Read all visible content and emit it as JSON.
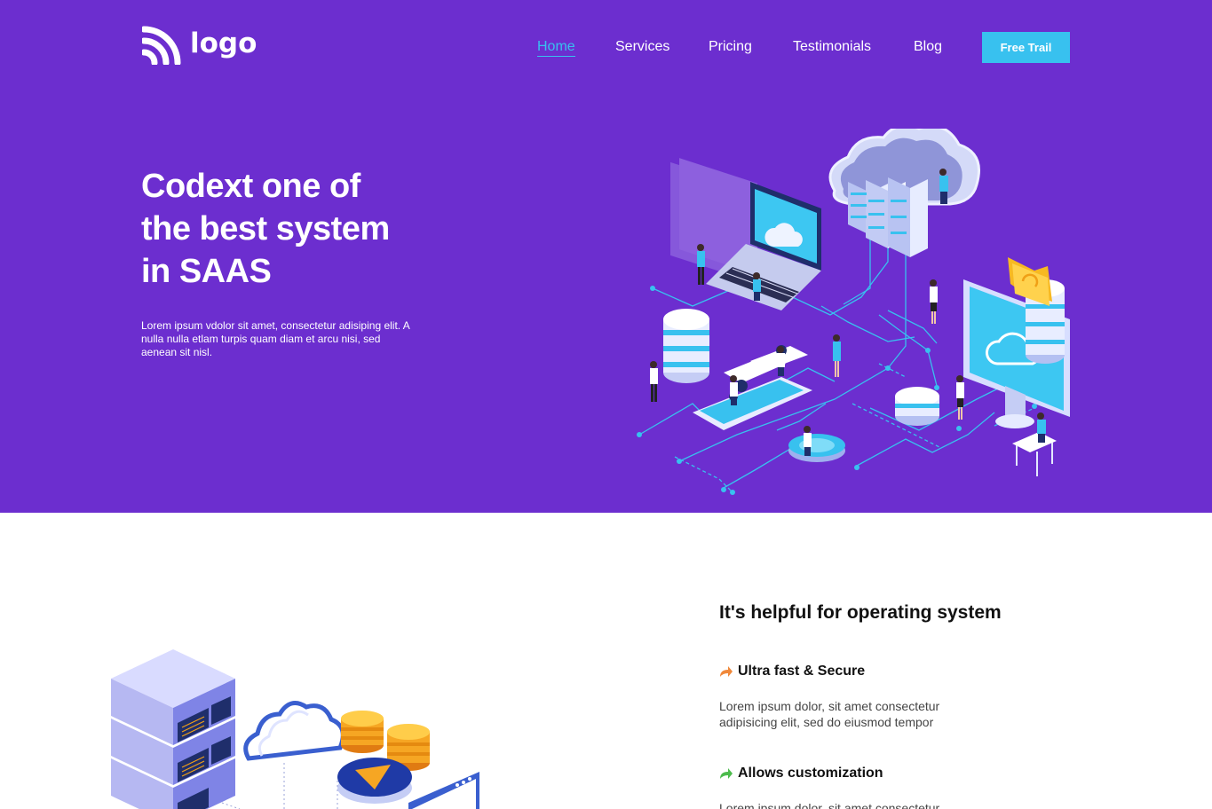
{
  "brand": {
    "name": "logo",
    "icon": "wifi-signal-icon"
  },
  "nav": {
    "items": [
      {
        "label": "Home",
        "active": true
      },
      {
        "label": "Services",
        "active": false
      },
      {
        "label": "Pricing",
        "active": false
      },
      {
        "label": "Testimonials",
        "active": false
      },
      {
        "label": "Blog",
        "active": false
      }
    ],
    "cta_label": "Free Trail"
  },
  "hero": {
    "title_lines": [
      "Codext one of",
      "the best system",
      "in SAAS"
    ],
    "description": "Lorem ipsum vdolor sit amet, consectetur adisiping elit. A nulla nulla etlam turpis quam diam et arcu nisi, sed aenean sit nisl."
  },
  "features_section": {
    "title": "It's helpful for operating system",
    "features": [
      {
        "icon": "share-arrow-icon",
        "title": "Ultra fast & Secure",
        "description": "Lorem ipsum dolor, sit amet consectetur adipisicing elit, sed do eiusmod tempor"
      },
      {
        "icon": "share-arrow-icon",
        "title": "Allows customization",
        "description": "Lorem ipsum dolor, sit amet consectetur"
      }
    ]
  },
  "colors": {
    "hero_bg": "#6c2ecf",
    "accent": "#38c1ef",
    "feature_icon_orange": "#f0883a",
    "feature_icon_green": "#4cbb4c"
  }
}
